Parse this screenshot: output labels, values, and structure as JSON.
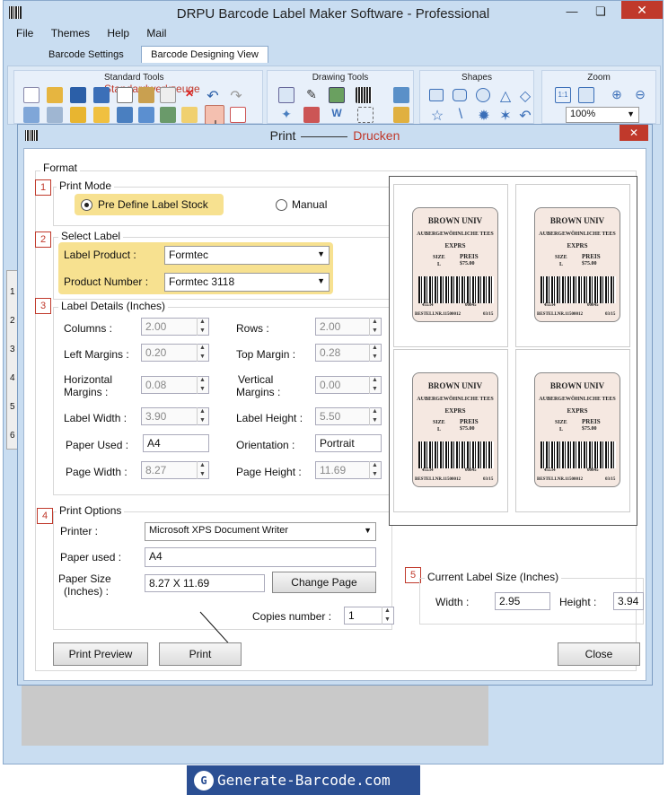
{
  "app": {
    "title": "DRPU Barcode Label Maker Software - Professional"
  },
  "menu": [
    "File",
    "Themes",
    "Help",
    "Mail"
  ],
  "tabs": [
    "Barcode Settings",
    "Barcode Designing View"
  ],
  "ribbon": {
    "standard_tools": "Standard Tools",
    "standard_tools_note": "Standardwerkzeuge",
    "drawing_tools": "Drawing Tools",
    "shapes": "Shapes",
    "zoom": "Zoom",
    "zoom_value": "100%"
  },
  "side_numbers": [
    "1",
    "2",
    "3",
    "4",
    "5",
    "6"
  ],
  "dialog": {
    "title": "Print",
    "title_note": "Drucken",
    "format_legend": "Format",
    "print_mode": {
      "legend": "Print Mode",
      "badge": "1",
      "option_predefine": "Pre Define Label Stock",
      "option_manual": "Manual"
    },
    "select_label": {
      "legend": "Select Label",
      "badge": "2",
      "product_label": "Label Product :",
      "product_value": "Formtec",
      "number_label": "Product Number :",
      "number_value": "Formtec 3118"
    },
    "label_details": {
      "legend": "Label Details (Inches)",
      "badge": "3",
      "columns_label": "Columns :",
      "columns_value": "2.00",
      "rows_label": "Rows :",
      "rows_value": "2.00",
      "left_margins_label": "Left Margins :",
      "left_margins_value": "0.20",
      "top_margin_label": "Top Margin :",
      "top_margin_value": "0.28",
      "hmargins_label_1": "Horizontal",
      "hmargins_label_2": "Margins :",
      "hmargins_value": "0.08",
      "vmargins_label_1": "Vertical",
      "vmargins_label_2": "Margins :",
      "vmargins_value": "0.00",
      "label_width_label": "Label Width :",
      "label_width_value": "3.90",
      "label_height_label": "Label Height :",
      "label_height_value": "5.50",
      "paper_used_label": "Paper Used :",
      "paper_used_value": "A4",
      "orientation_label": "Orientation :",
      "orientation_value": "Portrait",
      "page_width_label": "Page Width :",
      "page_width_value": "8.27",
      "page_height_label": "Page Height :",
      "page_height_value": "11.69"
    },
    "print_options": {
      "legend": "Print Options",
      "badge": "4",
      "printer_label": "Printer :",
      "printer_value": "Microsoft XPS Document Writer",
      "paper_used_label": "Paper used :",
      "paper_used_value": "A4",
      "paper_size_label_1": "Paper Size",
      "paper_size_label_2": "(Inches) :",
      "paper_size_value": "8.27 X 11.69",
      "change_page": "Change Page",
      "copies_label": "Copies number :",
      "copies_value": "1"
    },
    "current_label": {
      "legend": "Current Label Size (Inches)",
      "badge": "5",
      "width_label": "Width :",
      "width_value": "2.95",
      "height_label": "Height :",
      "height_value": "3.94"
    },
    "buttons": {
      "print_preview": "Print Preview",
      "print": "Print",
      "close": "Close"
    }
  },
  "label_card": {
    "line1": "BROWN UNIV",
    "line2": "AUBERGEWÖHNLICHE TEES",
    "line3": "EXPRS",
    "size_label": "SIZE",
    "size_value": "L",
    "price_label": "PREIS",
    "price_value": "$75.00",
    "code_small": "03",
    "num_left": "45534",
    "num_right": "00045",
    "bottom_left": "BESTELLNR.11500012",
    "bottom_right": "03/15"
  },
  "footer": {
    "logo_text": "Generate-Barcode.com",
    "logo_mark": "G"
  }
}
